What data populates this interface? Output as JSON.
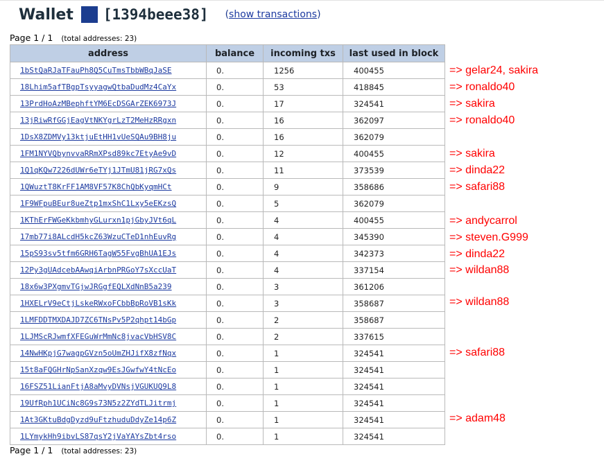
{
  "wallet": {
    "title_word": "Wallet",
    "id": "[1394beee38]",
    "show_transactions_prefix": "(",
    "show_transactions_link": "show transactions",
    "show_transactions_suffix": ")"
  },
  "pagination": {
    "label": "Page 1 / 1",
    "total": "(total addresses: 23)"
  },
  "table": {
    "headers": [
      "address",
      "balance",
      "incoming txs",
      "last used in block"
    ],
    "rows": [
      {
        "address": "1bStQaRJaTFauPh8Q5CuTmsTbbWBqJaSE",
        "balance": "0.",
        "incoming_txs": "1256",
        "last_block": "400455"
      },
      {
        "address": "18Lhim5afTBgpTsyyagwQtbaDudMz4CaYx",
        "balance": "0.",
        "incoming_txs": "53",
        "last_block": "418845"
      },
      {
        "address": "13PrdHoAzMBephftYM6EcDSGArZEK6973J",
        "balance": "0.",
        "incoming_txs": "17",
        "last_block": "324541"
      },
      {
        "address": "13jRiwRfGGjEagVtNKYgrLzT2MeHzRRgxn",
        "balance": "0.",
        "incoming_txs": "16",
        "last_block": "362097"
      },
      {
        "address": "1DsX8ZDMVy13ktjuEtHH1vUeSQAu9BH8ju",
        "balance": "0.",
        "incoming_txs": "16",
        "last_block": "362079"
      },
      {
        "address": "1FM1NYVQbynvvaRRmXPsd89kc7EtyAe9vD",
        "balance": "0.",
        "incoming_txs": "12",
        "last_block": "400455"
      },
      {
        "address": "1Q1qKQw7226dUWr6eTYj1JTmU81jRG7xQs",
        "balance": "0.",
        "incoming_txs": "11",
        "last_block": "373539"
      },
      {
        "address": "1QWuztT8KrFF1AM8VF57K8ChQbKyqmHCt",
        "balance": "0.",
        "incoming_txs": "9",
        "last_block": "358686"
      },
      {
        "address": "1F9WFpuBEur8ueZtp1mxShC1Lxy5eEKzsQ",
        "balance": "0.",
        "incoming_txs": "5",
        "last_block": "362079"
      },
      {
        "address": "1KThErFWGeKkbmhyGLurxn1pjGbyJVt6qL",
        "balance": "0.",
        "incoming_txs": "4",
        "last_block": "400455"
      },
      {
        "address": "17mb77i8ALcdH5kcZ63WzuCTeD1nhEuvRg",
        "balance": "0.",
        "incoming_txs": "4",
        "last_block": "345390"
      },
      {
        "address": "15pS93sv5tfm6GRH6TagW55FvgBhUA1EJs",
        "balance": "0.",
        "incoming_txs": "4",
        "last_block": "342373"
      },
      {
        "address": "12Py3gUAdcebAAwqiArbnPRGoY7sXccUaT",
        "balance": "0.",
        "incoming_txs": "4",
        "last_block": "337154"
      },
      {
        "address": "18x6w3PXgmvTGjwJRGgfEQLXdNnB5a239",
        "balance": "0.",
        "incoming_txs": "3",
        "last_block": "361206"
      },
      {
        "address": "1HXELrV9eCtjLskeRWxoFCbbBpRoVB1sKk",
        "balance": "0.",
        "incoming_txs": "3",
        "last_block": "358687"
      },
      {
        "address": "1LMFDDTMXDAJD7ZC6TNsPv5P2qhpt14bGp",
        "balance": "0.",
        "incoming_txs": "2",
        "last_block": "358687"
      },
      {
        "address": "1LJMScRJwmfXFEGuWrMmNc8jvacVbHSV8C",
        "balance": "0.",
        "incoming_txs": "2",
        "last_block": "337615"
      },
      {
        "address": "14NwHKpjG7wagpGVzn5oUmZHJifX8zfNqx",
        "balance": "0.",
        "incoming_txs": "1",
        "last_block": "324541"
      },
      {
        "address": "15t8aFQGHrNpSanXzqw9EsJGwfwY4tNcEo",
        "balance": "0.",
        "incoming_txs": "1",
        "last_block": "324541"
      },
      {
        "address": "16FSZ51LianFtjA8aMvyDVNsjVGUKUQ9L8",
        "balance": "0.",
        "incoming_txs": "1",
        "last_block": "324541"
      },
      {
        "address": "19UfRph1UCiNc8G9s73N5z2ZYdTLJitrmj",
        "balance": "0.",
        "incoming_txs": "1",
        "last_block": "324541"
      },
      {
        "address": "1At3GKtuBdgDyzd9uFtzhuduDdyZe14p6Z",
        "balance": "0.",
        "incoming_txs": "1",
        "last_block": "324541"
      },
      {
        "address": "1LYmykHh9ibvLS87qsY2jVaYAYsZbt4rso",
        "balance": "0.",
        "incoming_txs": "1",
        "last_block": "324541"
      }
    ]
  },
  "annotations": [
    "=> gelar24, sakira",
    "=> ronaldo40",
    "=> sakira",
    "=> ronaldo40",
    "=> sakira",
    "=> dinda22",
    "=> safari88",
    "=> andycarrol",
    "=> steven.G999",
    "=> dinda22",
    "=> wildan88",
    "=> wildan88",
    "=> safari88",
    "=> adam48"
  ],
  "colors": {
    "header_bg": "#bfcfe5",
    "link": "#1c3aa0",
    "annotation": "#ff0000",
    "wallet_square": "#1c3d8f"
  }
}
